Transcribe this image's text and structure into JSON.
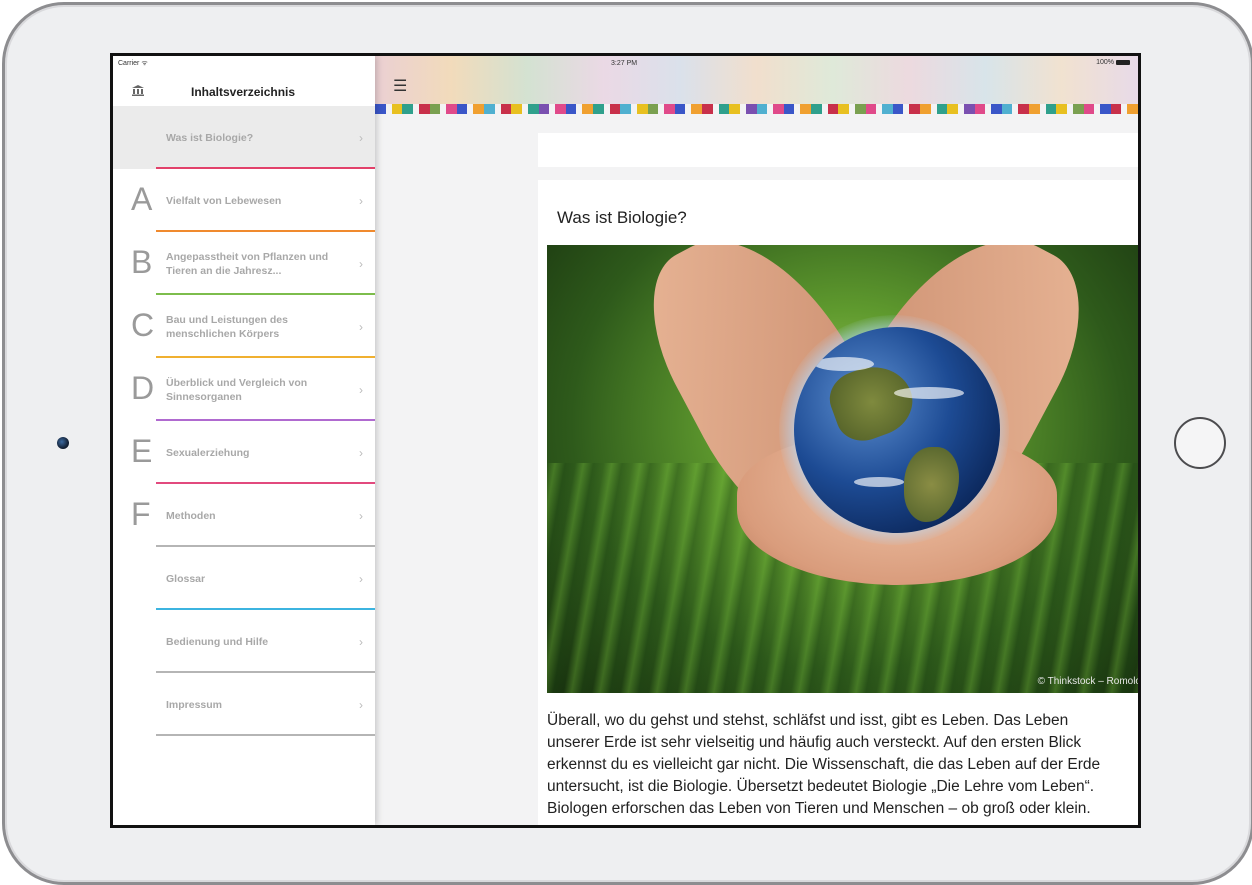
{
  "status_bar": {
    "carrier": "Carrier ᯤ",
    "time": "3:27 PM",
    "battery": "100%"
  },
  "sidebar": {
    "title": "Inhaltsverzeichnis",
    "items": [
      {
        "letter": "",
        "label": "Was ist Biologie?",
        "line_color": "#e2416a",
        "selected": true
      },
      {
        "letter": "A",
        "label": "Vielfalt von Lebewesen",
        "line_color": "#f08a2e"
      },
      {
        "letter": "B",
        "label": "Angepasstheit von Pflanzen und Tieren an die Jahresz...",
        "line_color": "#7dbd4c"
      },
      {
        "letter": "C",
        "label": "Bau und Leistungen des menschlichen Körpers",
        "line_color": "#f0b030"
      },
      {
        "letter": "D",
        "label": "Überblick und Vergleich von Sinnesorganen",
        "line_color": "#b06ad0"
      },
      {
        "letter": "E",
        "label": "Sexualerziehung",
        "line_color": "#e24a7e"
      },
      {
        "letter": "F",
        "label": "Methoden",
        "line_color": "#b5b5b5"
      },
      {
        "letter": "",
        "label": "Glossar",
        "line_color": "#3cb4e0"
      },
      {
        "letter": "",
        "label": "Bedienung und Hilfe",
        "line_color": "#b5b5b5"
      },
      {
        "letter": "",
        "label": "Impressum",
        "line_color": "#b5b5b5"
      }
    ],
    "chevron": "›"
  },
  "toolbar": {
    "menu_icon": "☰"
  },
  "color_strip": [
    "#3a56c8",
    "#e8c020",
    "#2fa08c",
    "#c8304a",
    "#7aa050",
    "#e04a8a",
    "#3a56c8",
    "#f0a030",
    "#50b0d0",
    "#c8304a",
    "#e8c020",
    "#2fa08c",
    "#7a50b0",
    "#e04a8a",
    "#3a56c8",
    "#f0a030",
    "#2fa08c",
    "#c8304a",
    "#50b0d0",
    "#e8c020",
    "#7aa050",
    "#e04a8a",
    "#3a56c8",
    "#f0a030",
    "#c8304a",
    "#2fa08c",
    "#e8c020",
    "#7a50b0",
    "#50b0d0",
    "#e04a8a",
    "#3a56c8",
    "#f0a030",
    "#2fa08c",
    "#c8304a",
    "#e8c020",
    "#7aa050",
    "#e04a8a",
    "#50b0d0",
    "#3a56c8",
    "#c8304a",
    "#f0a030",
    "#2fa08c",
    "#e8c020",
    "#7a50b0",
    "#e04a8a",
    "#3a56c8",
    "#50b0d0",
    "#c8304a",
    "#f0a030",
    "#2fa08c",
    "#e8c020",
    "#7aa050",
    "#e04a8a",
    "#3a56c8",
    "#c8304a",
    "#f0a030"
  ],
  "article": {
    "title": "Was ist Biologie?",
    "image_credit": "© Thinkstock – Romolo",
    "lines": [
      "Überall, wo du gehst und stehst, schläfst und isst, gibt es Leben. Das Leben",
      "unserer Erde ist sehr vielseitig und häufig auch versteckt. Auf den ersten Blick",
      "erkennst du es vielleicht gar nicht. Die Wissenschaft, die das Leben auf der Erde",
      "untersucht, ist die Biologie. Übersetzt bedeutet Biologie „Die Lehre vom Leben“.",
      "Biologen erforschen das Leben von Tieren und Menschen – ob groß oder klein."
    ]
  }
}
